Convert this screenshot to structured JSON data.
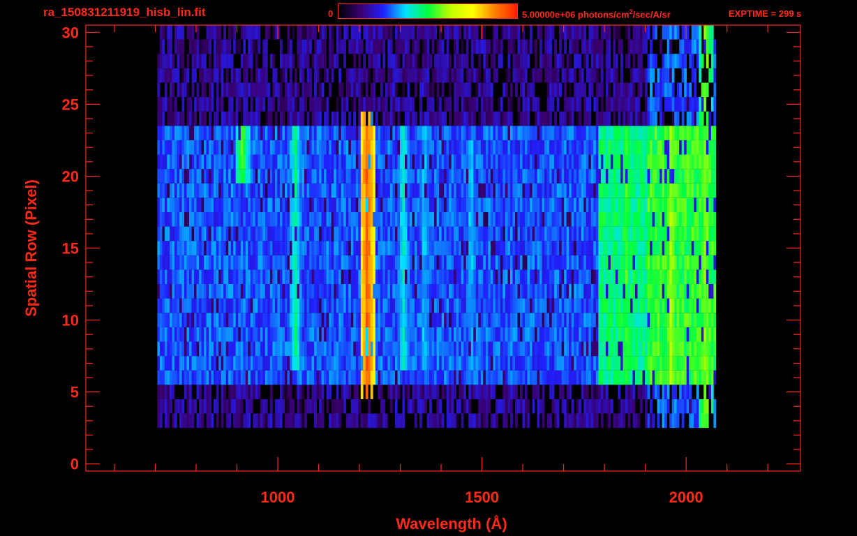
{
  "header": {
    "filename": "ra_150831211919_hisb_lin.fit",
    "colorbar_min": "0",
    "colorbar_max_text": "5.00000e+06 photons/cm",
    "colorbar_max_sup": "2",
    "colorbar_max_tail": "/sec/A/sr",
    "exptime": "EXPTIME = 299 s"
  },
  "chart_data": {
    "type": "heatmap",
    "xlabel": "Wavelength (Å)",
    "ylabel": "Spatial Row (Pixel)",
    "xlim": [
      530,
      2280
    ],
    "ylim": [
      -0.5,
      30.5
    ],
    "x_ticks": [
      1000,
      1500,
      2000
    ],
    "y_ticks": [
      0,
      5,
      10,
      15,
      20,
      25,
      30
    ],
    "x_minor_step": 100,
    "y_minor_step": 1,
    "grid": false,
    "colormap": [
      "#000000",
      "#3a0070",
      "#2020ff",
      "#00e0ff",
      "#00ff40",
      "#c0ff00",
      "#ffff00",
      "#ff8000",
      "#ff2000"
    ],
    "color_range": [
      0,
      5000000
    ],
    "data_extent": {
      "x_start": 705,
      "x_end": 2070,
      "bright_rows": [
        6,
        23
      ],
      "faint_rows": [
        3,
        30
      ]
    },
    "emission_features": [
      {
        "wavelength": 1216,
        "rows": [
          5,
          24
        ],
        "level": 0.92
      },
      {
        "wavelength": 1040,
        "rows": [
          7,
          23
        ],
        "level": 0.45
      },
      {
        "wavelength": 1304,
        "rows": [
          7,
          23
        ],
        "level": 0.42
      },
      {
        "wavelength": 1356,
        "rows": [
          7,
          23
        ],
        "level": 0.38
      },
      {
        "wavelength": 1470,
        "rows": [
          7,
          22
        ],
        "level": 0.38
      },
      {
        "wavelength": 910,
        "rows": [
          20,
          23
        ],
        "level": 0.55
      },
      {
        "wavelength": 1850,
        "rows": [
          6,
          23
        ],
        "level": 0.55
      },
      {
        "wavelength": 1960,
        "rows": [
          6,
          23
        ],
        "level": 0.62
      },
      {
        "wavelength": 2045,
        "rows": [
          1,
          30
        ],
        "level": 0.6
      }
    ]
  }
}
